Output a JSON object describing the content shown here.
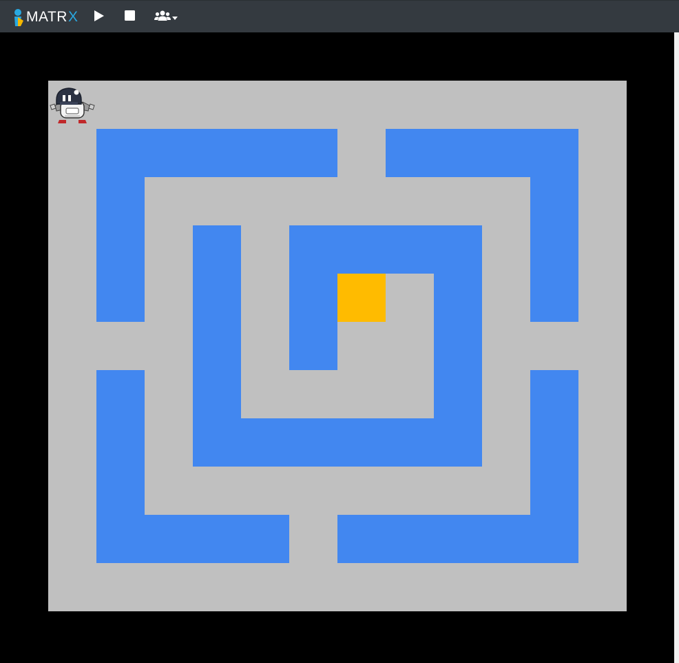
{
  "toolbar": {
    "brand_main": "MATR",
    "brand_accent": "X",
    "icons": [
      "matrx-logo-icon",
      "play-icon",
      "stop-icon",
      "users-icon",
      "caret-down-icon"
    ]
  },
  "colors": {
    "toolbar_bg": "#343a40",
    "background": "#000000",
    "floor": "#c0c0c0",
    "wall": "#4287f0",
    "goal": "#ffbb00",
    "logo_blue": "#29a8e0",
    "logo_yellow": "#f5b800"
  },
  "grid": {
    "cols": 12,
    "rows": 11,
    "floor": {
      "col": 0,
      "row": 0,
      "w": 12,
      "h": 11
    },
    "walls": [
      {
        "col": 1,
        "row": 1,
        "w": 5,
        "h": 1
      },
      {
        "col": 1,
        "row": 2,
        "w": 1,
        "h": 3
      },
      {
        "col": 7,
        "row": 1,
        "w": 4,
        "h": 1
      },
      {
        "col": 10,
        "row": 2,
        "w": 1,
        "h": 3
      },
      {
        "col": 3,
        "row": 3,
        "w": 1,
        "h": 5
      },
      {
        "col": 5,
        "row": 3,
        "w": 4,
        "h": 1
      },
      {
        "col": 5,
        "row": 4,
        "w": 1,
        "h": 2
      },
      {
        "col": 8,
        "row": 4,
        "w": 1,
        "h": 4
      },
      {
        "col": 4,
        "row": 7,
        "w": 4,
        "h": 1
      },
      {
        "col": 1,
        "row": 6,
        "w": 1,
        "h": 4
      },
      {
        "col": 2,
        "row": 9,
        "w": 3,
        "h": 1
      },
      {
        "col": 10,
        "row": 6,
        "w": 1,
        "h": 4
      },
      {
        "col": 6,
        "row": 9,
        "w": 4,
        "h": 1
      }
    ],
    "goal": {
      "col": 6,
      "row": 4
    },
    "agent": {
      "col": 0,
      "row": 0,
      "icon": "robot-icon"
    }
  }
}
